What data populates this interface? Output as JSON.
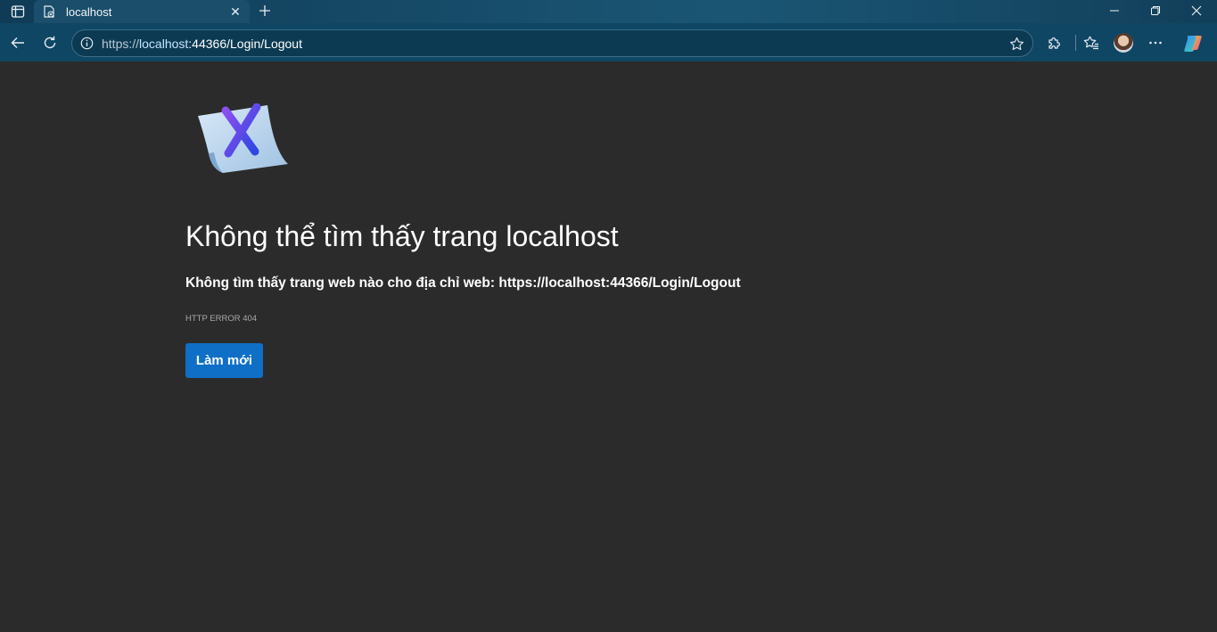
{
  "browser": {
    "tab": {
      "title": "localhost"
    },
    "address_bar": {
      "url_scheme": "https://",
      "url_host": "localhost",
      "url_rest": ":44366/Login/Logout"
    },
    "icons": {
      "tab_actions": "tab-actions-icon",
      "favicon": "page-error-icon",
      "tab_close": "close-icon",
      "new_tab": "plus-icon",
      "back": "back-arrow-icon",
      "reload": "reload-icon",
      "site_info": "info-icon",
      "favorite": "star-icon",
      "extensions": "puzzle-icon",
      "favorites": "favorites-star-icon",
      "profile": "profile-avatar",
      "more": "more-dots-icon",
      "copilot": "copilot-icon",
      "minimize": "minimize-icon",
      "restore": "restore-icon",
      "close_window": "close-icon"
    }
  },
  "page": {
    "heading": "Không thể tìm thấy trang localhost",
    "description_prefix": "Không tìm thấy trang web nào cho địa chỉ web: ",
    "description_url": "https://localhost:44366/Login/Logout",
    "error_code": "HTTP ERROR 404",
    "refresh_button": "Làm mới"
  },
  "colors": {
    "page_background": "#2b2b2b",
    "toolbar": "#0f4664",
    "button": "#0f6fc6"
  }
}
